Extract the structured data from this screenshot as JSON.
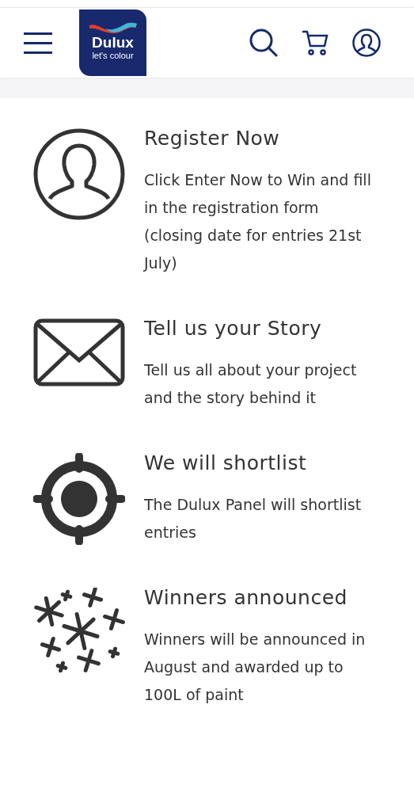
{
  "header": {
    "logo": {
      "brand": "Dulux",
      "tagline": "let's colour"
    }
  },
  "steps": [
    {
      "kind": "person",
      "title": "Register Now",
      "body": "Click Enter Now to Win and fill in the registration form (closing date for entries 21st July)"
    },
    {
      "kind": "envelope",
      "title": "Tell us your Story",
      "body": "Tell us all about your project and the story behind it"
    },
    {
      "kind": "target",
      "title": "We will shortlist",
      "body": "The Dulux Panel will shortlist entries"
    },
    {
      "kind": "sparkles",
      "title": "Winners announced",
      "body": "Winners will be announced in August and awarded up to 100L of paint"
    }
  ]
}
